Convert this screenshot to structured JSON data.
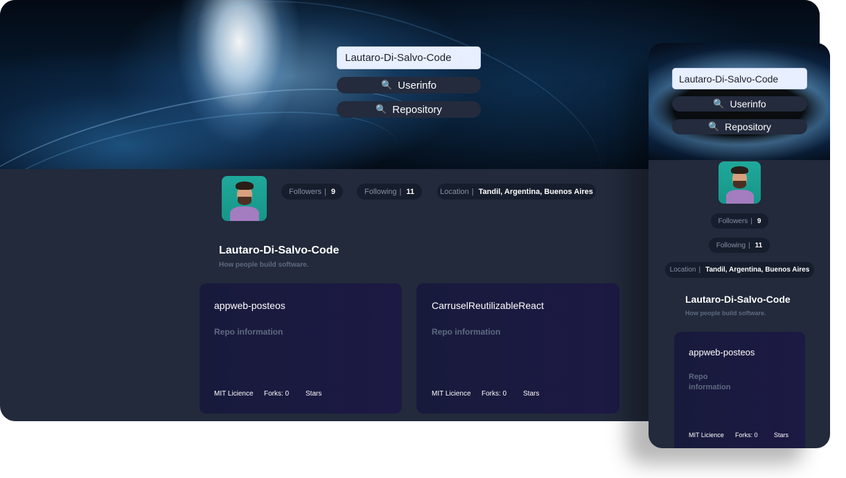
{
  "search": {
    "value": "Lautaro-Di-Salvo-Code"
  },
  "buttons": {
    "userinfo_icon": "🔍",
    "userinfo_label": "Userinfo",
    "repository_icon": "🔍",
    "repository_label": "Repository"
  },
  "profile": {
    "followers_label": "Followers",
    "followers_value": "9",
    "following_label": "Following",
    "following_value": "11",
    "location_label": "Location",
    "location_value": "Tandil, Argentina, Buenos Aires",
    "separator": "|",
    "username": "Lautaro-Di-Salvo-Code",
    "tagline": "How people build software."
  },
  "repos": [
    {
      "name": "appweb-posteos",
      "info": "Repo information",
      "license": "MIT Licience",
      "forks": "Forks: 0",
      "stars": "Stars"
    },
    {
      "name": "CarruselReutilizableReact",
      "info": "Repo information",
      "license": "MIT Licience",
      "forks": "Forks: 0",
      "stars": "Stars"
    }
  ],
  "colors": {
    "background": "#222a3b",
    "pill": "#161d2c",
    "button": "#232b3d",
    "card": "#1b1942",
    "input": "#e8efff"
  },
  "icons": {
    "search": "magnifier-icon"
  }
}
